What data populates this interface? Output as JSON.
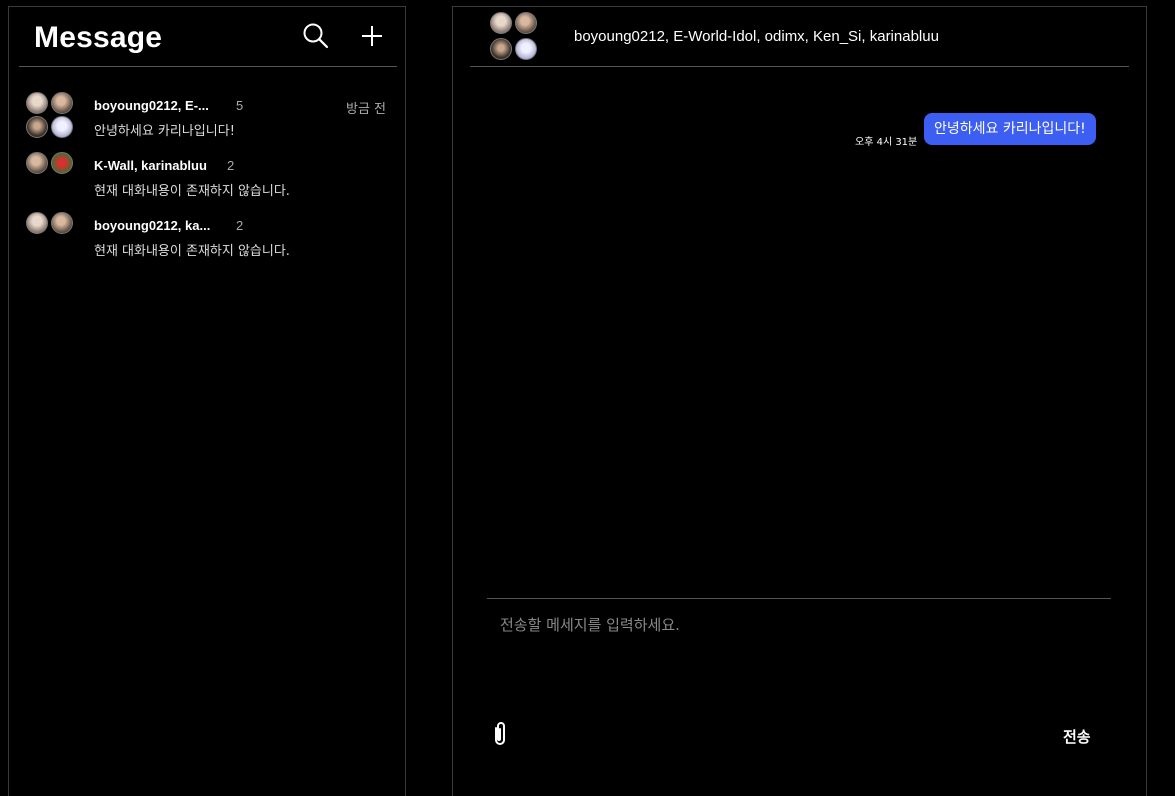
{
  "sidebar": {
    "title": "Message",
    "search_icon": "search-icon",
    "add_icon": "plus-icon",
    "conversations": [
      {
        "name": "boyoung0212, E-...",
        "count": "5",
        "time": "방금 전",
        "preview": "안녕하세요 카리나입니다!",
        "avatars": [
          "avatar-photo",
          "avatar-photo",
          "avatar-photo",
          "avatar-photo"
        ]
      },
      {
        "name": "K-Wall, karinabluu",
        "count": "2",
        "time": "",
        "preview": "현재 대화내용이 존재하지 않습니다.",
        "avatars": [
          "avatar-photo",
          "avatar-photo"
        ]
      },
      {
        "name": "boyoung0212, ka...",
        "count": "2",
        "time": "",
        "preview": "현재 대화내용이 존재하지 않습니다.",
        "avatars": [
          "avatar-photo",
          "avatar-photo"
        ]
      }
    ]
  },
  "chat": {
    "title": "boyoung0212, E-World-Idol, odimx, Ken_Si, karinabluu",
    "messages": [
      {
        "time": "오후 4시 31분",
        "text": "안녕하세요 카리나입니다!"
      }
    ],
    "input_placeholder": "전송할 메세지를 입력하세요.",
    "attach_icon": "paperclip-icon",
    "send_label": "전송"
  },
  "colors": {
    "background": "#000000",
    "bubble": "#3d5ef2",
    "border": "#3a3a3a"
  }
}
